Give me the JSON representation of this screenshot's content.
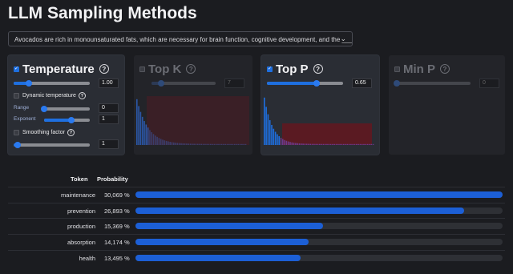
{
  "app": {
    "title": "LLM Sampling Methods"
  },
  "prompt": {
    "text": "Avocados are rich in monounsaturated fats, which are necessary for brain function, cognitive development, and the _____",
    "chevron_icon": "chevron-down-icon"
  },
  "panels": {
    "temperature": {
      "name": "Temperature",
      "enabled": true,
      "value": "1.00",
      "slider_fraction": 0.2,
      "dynamic": {
        "label": "Dynamic temperature",
        "enabled": false,
        "range_label": "Range",
        "range_value": "0",
        "range_fraction": 0.0,
        "exponent_label": "Exponent",
        "exponent_value": "1",
        "exponent_fraction": 0.6
      },
      "smoothing": {
        "label": "Smoothing factor",
        "enabled": false,
        "value": "1",
        "slider_fraction": 0.05
      }
    },
    "top_k": {
      "name": "Top K",
      "enabled": false,
      "value": "7",
      "slider_fraction": 0.15
    },
    "top_p": {
      "name": "Top P",
      "enabled": true,
      "value": "0.65",
      "slider_fraction": 0.65
    },
    "min_p": {
      "name": "Min P",
      "enabled": false,
      "value": "0",
      "slider_fraction": 0.0
    }
  },
  "table": {
    "headers": {
      "token": "Token",
      "probability": "Probability"
    },
    "rows": [
      {
        "token": "maintenance",
        "probability": "30,069 %",
        "value": 30.069
      },
      {
        "token": "prevention",
        "probability": "26,893 %",
        "value": 26.893
      },
      {
        "token": "production",
        "probability": "15,369 %",
        "value": 15.369
      },
      {
        "token": "absorption",
        "probability": "14,174 %",
        "value": 14.174
      },
      {
        "token": "health",
        "probability": "13,495 %",
        "value": 13.495
      }
    ]
  },
  "colors": {
    "accent": "#1e6fe0",
    "bar": "#1c5fd6",
    "cutoff": "#5a1a22"
  }
}
